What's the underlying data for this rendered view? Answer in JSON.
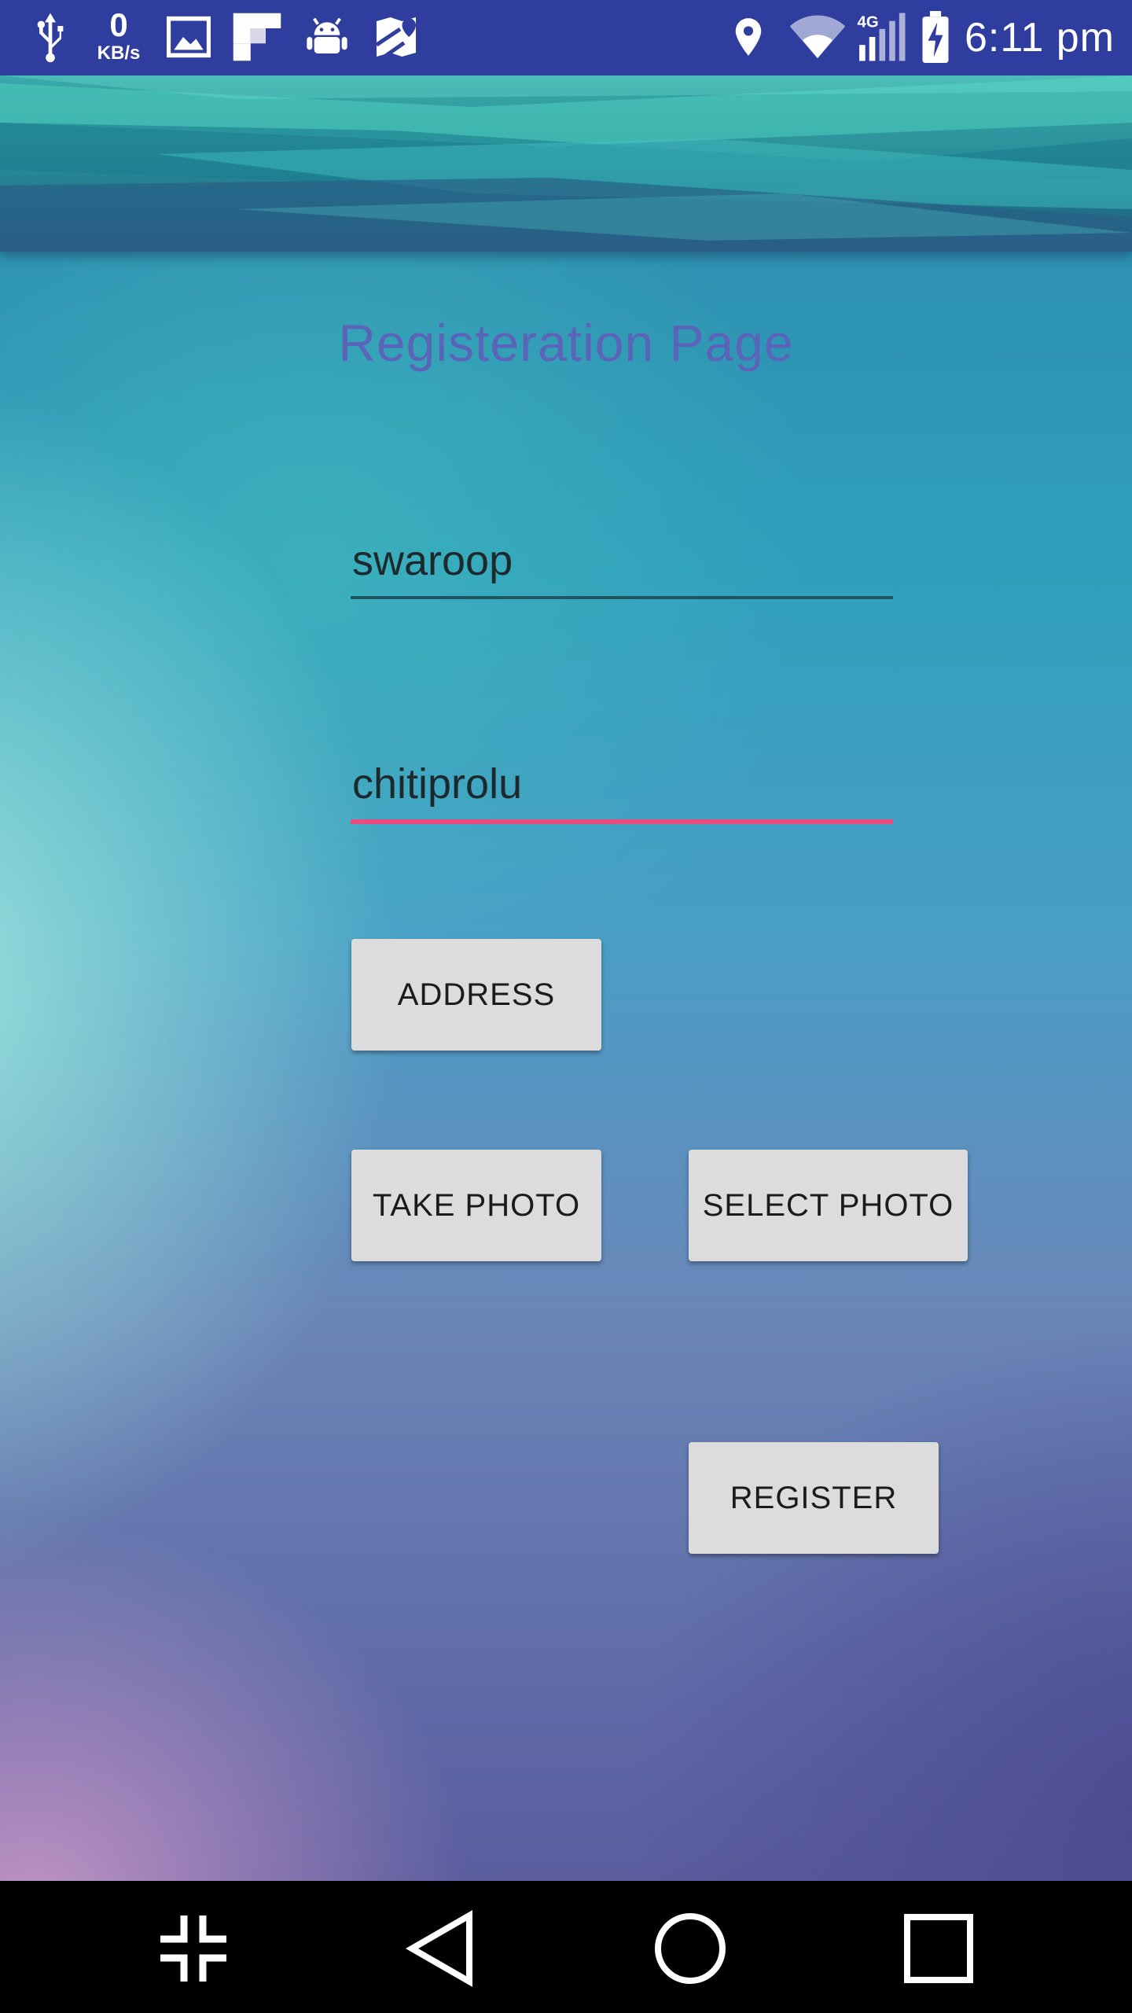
{
  "status_bar": {
    "icons": [
      "usb-icon",
      "gallery-icon",
      "flipboard-icon",
      "android-debug-icon",
      "maps-icon",
      "location-icon",
      "wifi-icon",
      "cell-signal-icon",
      "battery-charging-icon"
    ],
    "net_speed_value": "0",
    "net_speed_unit": "KB/s",
    "network_type": "4G",
    "time": "6:11 pm"
  },
  "page": {
    "title": "Registeration Page"
  },
  "form": {
    "first_name_value": "swaroop",
    "last_name_value": "chitiprolu",
    "address_button_label": "ADDRESS",
    "take_photo_button_label": "TAKE PHOTO",
    "select_photo_button_label": "SELECT PHOTO",
    "register_button_label": "REGISTER"
  },
  "colors": {
    "status_bar": "#2f3e9e",
    "title": "#5a64b8",
    "focused_underline": "#ec4a7c",
    "button_bg": "#dcdcdc"
  },
  "nav_bar": {
    "icons": [
      "collapse-icon",
      "back-icon",
      "home-icon",
      "recents-icon"
    ]
  }
}
